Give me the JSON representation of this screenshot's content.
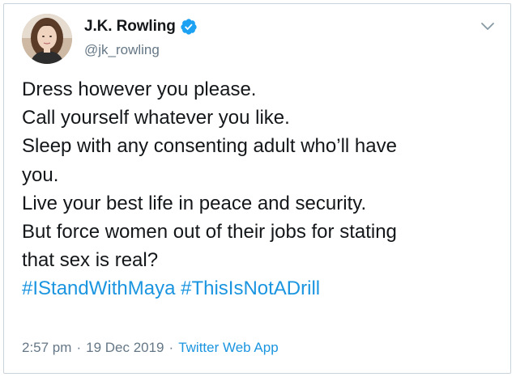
{
  "tweet": {
    "author": {
      "display_name": "J.K. Rowling",
      "handle": "@jk_rowling",
      "verified": true
    },
    "text_lines": [
      "Dress however you please.",
      "Call yourself whatever you like.",
      "Sleep with any consenting adult who’ll have",
      "you.",
      "Live your best life in peace and security.",
      "But force women out of their jobs for stating",
      "that sex is real?"
    ],
    "hashtags": [
      "#IStandWithMaya",
      "#ThisIsNotADrill"
    ],
    "time": "2:57 pm",
    "date": "19 Dec 2019",
    "separator": "·",
    "source": "Twitter Web App"
  },
  "colors": {
    "link": "#1b95e0",
    "text": "#14171a",
    "muted": "#657786",
    "verified_badge": "#1da1f2"
  },
  "icons": {
    "verified": "verified-badge-icon",
    "menu": "chevron-down-icon"
  }
}
